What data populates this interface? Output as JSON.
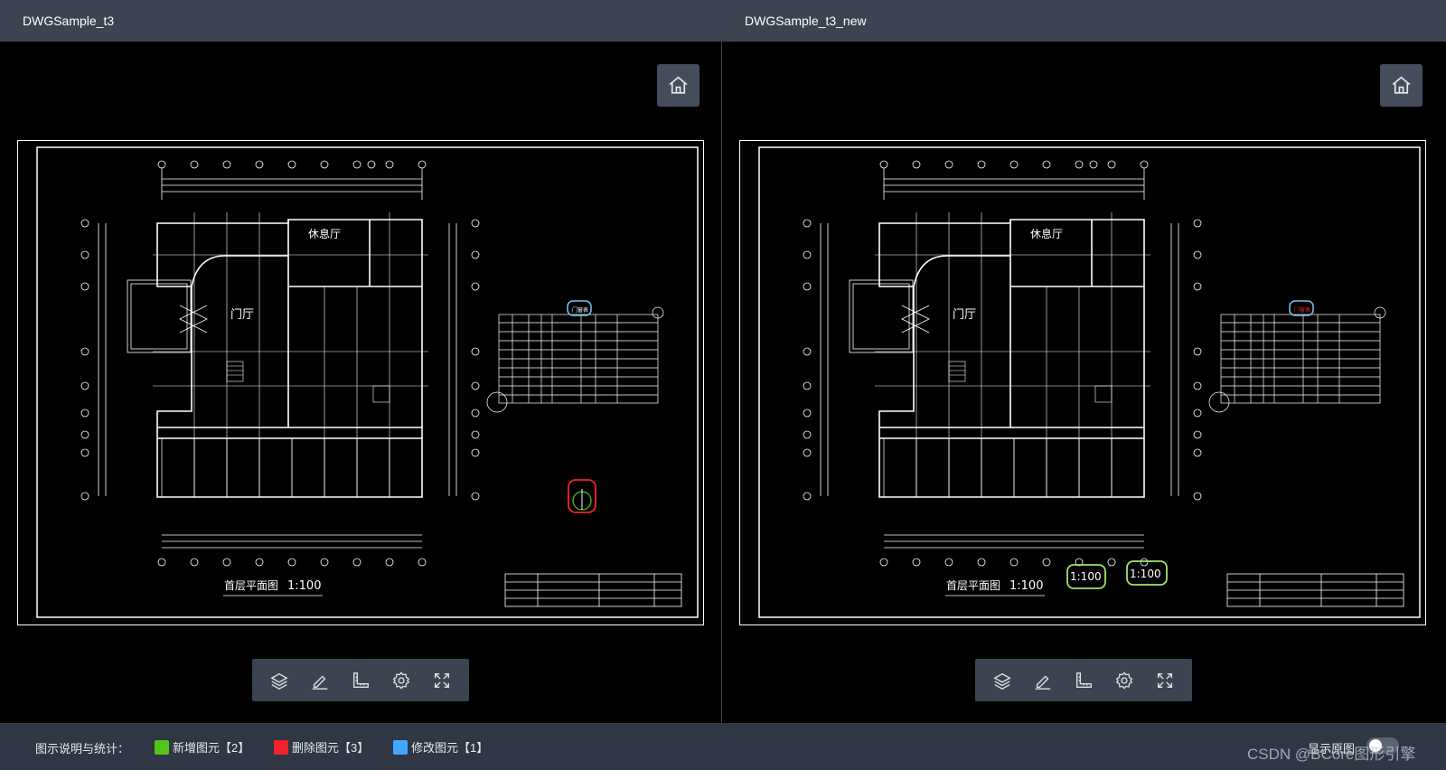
{
  "left": {
    "title": "DWGSample_t3",
    "drawing": {
      "hall_label": "休息厅",
      "lobby_label": "门厅",
      "plan_title": "首层平面图",
      "plan_scale": "1:100",
      "door_table_title": "门窗表"
    }
  },
  "right": {
    "title": "DWGSample_t3_new",
    "drawing": {
      "hall_label": "休息厅",
      "lobby_label": "门厅",
      "plan_title": "首层平面图",
      "plan_scale": "1:100",
      "door_table_title": "门窗表",
      "added_scale_1": "1:100",
      "added_scale_2": "1:100"
    }
  },
  "legend": {
    "title": "图示说明与统计：",
    "added": "新增图元【2】",
    "deleted": "删除图元【3】",
    "modified": "修改图元【1】"
  },
  "toggle_label": "显示原图",
  "watermark": "CSDN @BCore图形引擎",
  "colors": {
    "added": "#52c41a",
    "deleted": "#f5222d",
    "modified": "#40a9ff",
    "header_bg": "#3c4452",
    "bottom_bg": "#2f3745",
    "highlight_cyan": "#76c8f0"
  },
  "icons": {
    "home": "home-icon",
    "toolbar": [
      "layers-icon",
      "pen-icon",
      "ruler-icon",
      "gear-icon",
      "fullscreen-icon"
    ]
  }
}
